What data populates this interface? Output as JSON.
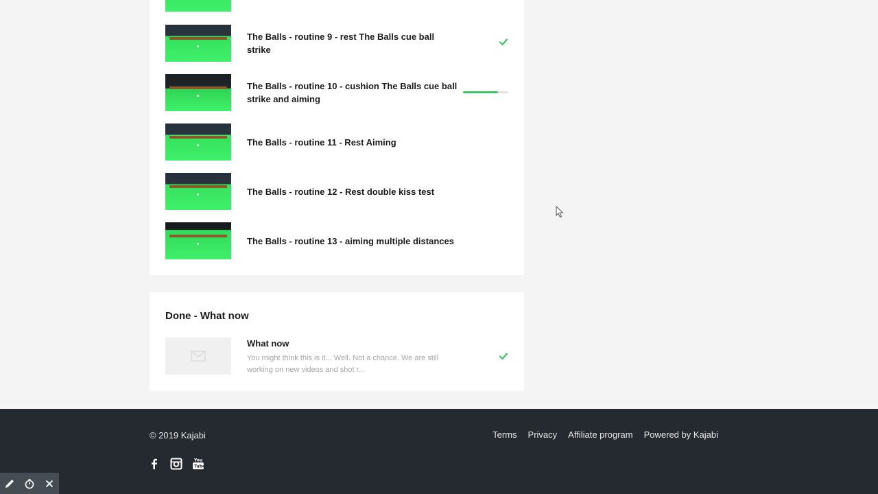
{
  "lessons": [
    {
      "title": "The Balls - routine 9 - rest The Balls cue ball strike",
      "status": "completed",
      "thumb": "green-table"
    },
    {
      "title": "The Balls - routine 10 - cushion The Balls cue ball strike and aiming",
      "status": "in-progress",
      "progress_percent": 78,
      "thumb": "dark-table"
    },
    {
      "title": "The Balls - routine 11 - Rest Aiming",
      "status": "not-started",
      "thumb": "green-table"
    },
    {
      "title": "The Balls - routine 12 - Rest double kiss test",
      "status": "not-started",
      "thumb": "green-table"
    },
    {
      "title": "The Balls - routine 13 - aiming multiple distances",
      "status": "not-started",
      "thumb": "player-table"
    }
  ],
  "done_section": {
    "title": "Done - What now",
    "post": {
      "title": "What now",
      "excerpt": "You might think this is it... Well. Not a chance. We are still working on new videos and shot r...",
      "status": "completed"
    }
  },
  "footer": {
    "copyright": "© 2019 Kajabi",
    "links": [
      "Terms",
      "Privacy",
      "Affiliate program",
      "Powered by Kajabi"
    ],
    "social_icons": [
      "facebook-icon",
      "instagram-icon",
      "youtube-icon"
    ]
  },
  "overlay_toolbar": {
    "icons": [
      "pen-icon",
      "timer-icon",
      "close-icon"
    ]
  },
  "colors": {
    "check_green": "#3cc565",
    "footer_bg": "#252a31",
    "page_bg": "#f4f4f4"
  }
}
